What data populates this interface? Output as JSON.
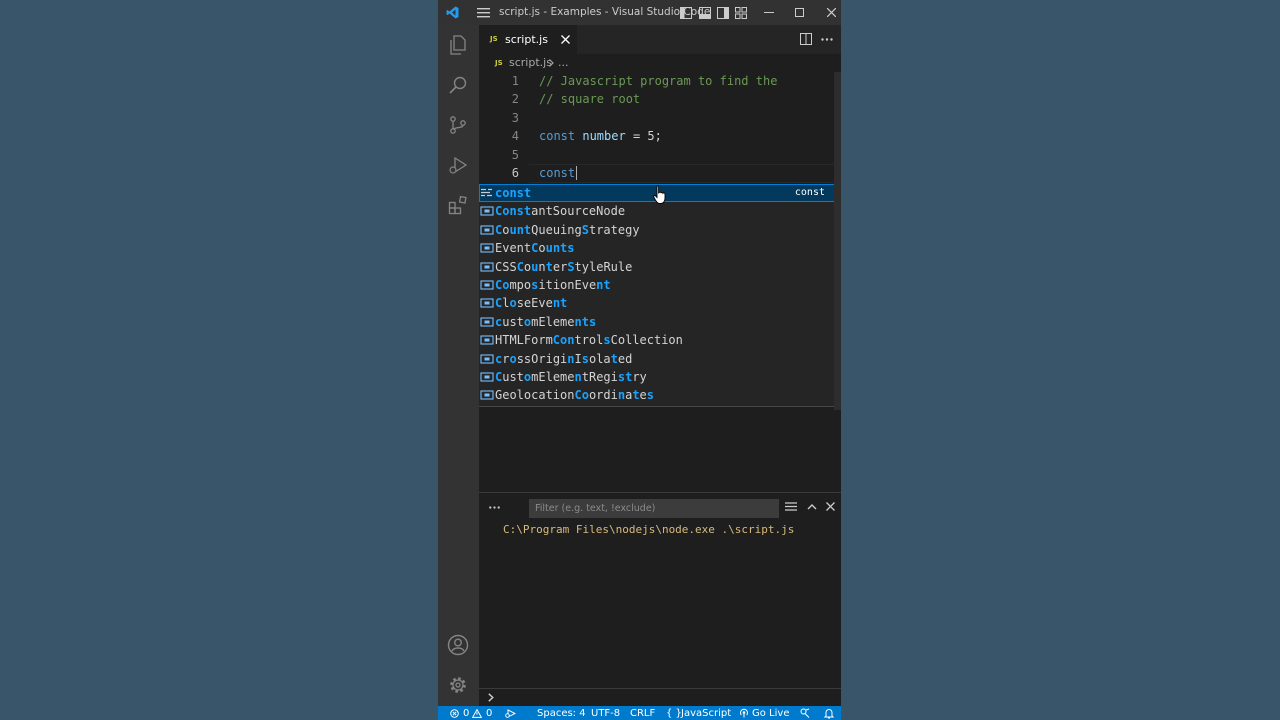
{
  "window": {
    "title": "script.js - Examples - Visual Studio Code"
  },
  "tab": {
    "filename": "script.js",
    "file_badge": "JS"
  },
  "breadcrumb": {
    "badge": "JS",
    "file": "script.js",
    "more": "..."
  },
  "editor": {
    "lines": [
      {
        "num": "1",
        "text": "// Javascript program to find the"
      },
      {
        "num": "2",
        "text": "// square root"
      },
      {
        "num": "3",
        "text": ""
      },
      {
        "num": "4",
        "kw": "const",
        "var": "number",
        "rest": " = 5;"
      },
      {
        "num": "5",
        "text": ""
      },
      {
        "num": "6",
        "kw": "const"
      }
    ]
  },
  "suggest": {
    "items": [
      {
        "segs": [
          {
            "t": "const",
            "m": true
          }
        ],
        "kind": "keyword",
        "detail": "const"
      },
      {
        "segs": [
          {
            "t": "Const",
            "m": true
          },
          {
            "t": "antSourceNode",
            "m": false
          }
        ],
        "kind": "variable"
      },
      {
        "segs": [
          {
            "t": "C",
            "m": true
          },
          {
            "t": "o",
            "m": false
          },
          {
            "t": "unt",
            "m": true
          },
          {
            "t": "Queuing",
            "m": false
          },
          {
            "t": "S",
            "m": true
          },
          {
            "t": "trategy",
            "m": false
          }
        ],
        "kind": "variable"
      },
      {
        "segs": [
          {
            "t": "Event",
            "m": false
          },
          {
            "t": "C",
            "m": true
          },
          {
            "t": "o",
            "m": false
          },
          {
            "t": "unts",
            "m": true
          }
        ],
        "kind": "variable"
      },
      {
        "segs": [
          {
            "t": "CSS",
            "m": false
          },
          {
            "t": "C",
            "m": true
          },
          {
            "t": "o",
            "m": false
          },
          {
            "t": "u",
            "m": true
          },
          {
            "t": "n",
            "m": false
          },
          {
            "t": "t",
            "m": true
          },
          {
            "t": "er",
            "m": false
          },
          {
            "t": "S",
            "m": true
          },
          {
            "t": "tyleRule",
            "m": false
          }
        ],
        "kind": "variable"
      },
      {
        "segs": [
          {
            "t": "Co",
            "m": true
          },
          {
            "t": "mpo",
            "m": false
          },
          {
            "t": "s",
            "m": true
          },
          {
            "t": "itionEve",
            "m": false
          },
          {
            "t": "nt",
            "m": true
          }
        ],
        "kind": "variable"
      },
      {
        "segs": [
          {
            "t": "C",
            "m": true
          },
          {
            "t": "l",
            "m": false
          },
          {
            "t": "o",
            "m": true
          },
          {
            "t": "seEve",
            "m": false
          },
          {
            "t": "nt",
            "m": true
          }
        ],
        "kind": "variable"
      },
      {
        "segs": [
          {
            "t": "c",
            "m": true
          },
          {
            "t": "ust",
            "m": false
          },
          {
            "t": "o",
            "m": true
          },
          {
            "t": "mEleme",
            "m": false
          },
          {
            "t": "nts",
            "m": true
          }
        ],
        "kind": "variable"
      },
      {
        "segs": [
          {
            "t": "HTMLForm",
            "m": false
          },
          {
            "t": "Con",
            "m": true
          },
          {
            "t": "trol",
            "m": false
          },
          {
            "t": "s",
            "m": true
          },
          {
            "t": "Collection",
            "m": false
          }
        ],
        "kind": "variable"
      },
      {
        "segs": [
          {
            "t": "c",
            "m": true
          },
          {
            "t": "r",
            "m": false
          },
          {
            "t": "o",
            "m": true
          },
          {
            "t": "ssOrigi",
            "m": false
          },
          {
            "t": "n",
            "m": true
          },
          {
            "t": "I",
            "m": false
          },
          {
            "t": "s",
            "m": true
          },
          {
            "t": "ola",
            "m": false
          },
          {
            "t": "t",
            "m": true
          },
          {
            "t": "ed",
            "m": false
          }
        ],
        "kind": "variable"
      },
      {
        "segs": [
          {
            "t": "C",
            "m": true
          },
          {
            "t": "ust",
            "m": false
          },
          {
            "t": "o",
            "m": true
          },
          {
            "t": "mEleme",
            "m": false
          },
          {
            "t": "n",
            "m": true
          },
          {
            "t": "tRegi",
            "m": false
          },
          {
            "t": "st",
            "m": true
          },
          {
            "t": "ry",
            "m": false
          }
        ],
        "kind": "variable"
      },
      {
        "segs": [
          {
            "t": "Geolocation",
            "m": false
          },
          {
            "t": "Co",
            "m": true
          },
          {
            "t": "ordi",
            "m": false
          },
          {
            "t": "n",
            "m": true
          },
          {
            "t": "a",
            "m": false
          },
          {
            "t": "t",
            "m": true
          },
          {
            "t": "e",
            "m": false
          },
          {
            "t": "s",
            "m": true
          }
        ],
        "kind": "variable"
      }
    ]
  },
  "panel": {
    "filter_placeholder": "Filter (e.g. text, !exclude)",
    "output_line": "C:\\Program Files\\nodejs\\node.exe .\\script.js"
  },
  "statusbar": {
    "errors": "0",
    "warnings": "0",
    "spaces": "Spaces: 4",
    "encoding": "UTF-8",
    "eol": "CRLF",
    "language": "JavaScript",
    "golive": "Go Live"
  },
  "colors": {
    "accent": "#007acc",
    "match": "#18a3ff",
    "comment": "#6a9955",
    "keyword": "#569cd6",
    "variable": "#9cdcfe",
    "output": "#d7ba7d"
  }
}
